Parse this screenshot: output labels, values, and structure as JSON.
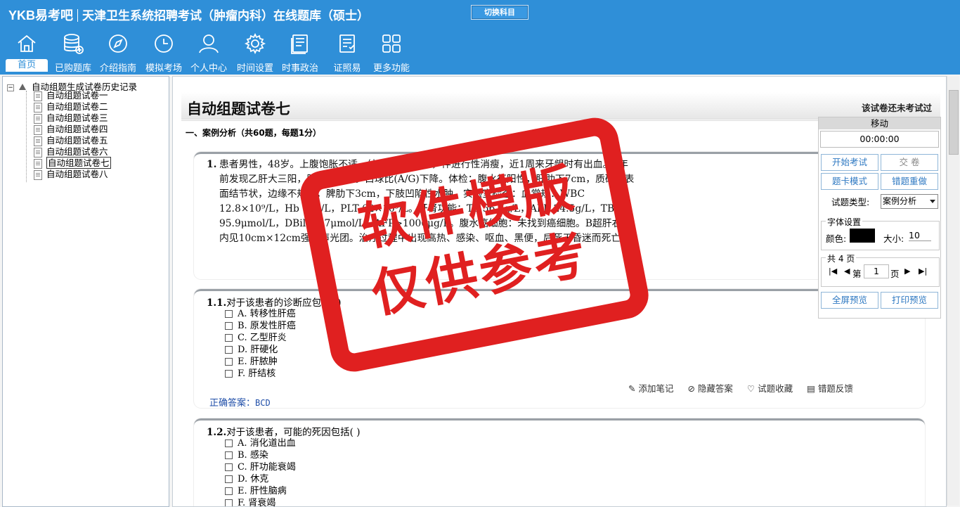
{
  "header": {
    "logo": "YKB易考吧",
    "title": "天津卫生系统招聘考试（肿瘤内科）在线题库（硕士）",
    "switch_label": "切换科目",
    "nav": [
      {
        "label": "首页",
        "icon": "home-icon"
      },
      {
        "label": "已购题库",
        "icon": "database-icon"
      },
      {
        "label": "介绍指南",
        "icon": "compass-icon"
      },
      {
        "label": "模拟考场",
        "icon": "clock-icon"
      },
      {
        "label": "个人中心",
        "icon": "user-icon"
      },
      {
        "label": "时间设置",
        "icon": "gear-icon"
      },
      {
        "label": "时事政治",
        "icon": "news-icon"
      },
      {
        "label": "证照易",
        "icon": "certificate-icon"
      },
      {
        "label": "更多功能",
        "icon": "grid-icon"
      }
    ]
  },
  "tree": {
    "root": "自动组题生成试卷历史记录",
    "items": [
      "自动组题试卷一",
      "自动组题试卷二",
      "自动组题试卷三",
      "自动组题试卷四",
      "自动组题试卷五",
      "自动组题试卷六",
      "自动组题试卷七",
      "自动组题试卷八"
    ]
  },
  "paper": {
    "title": "自动组题试卷七",
    "status": "该试卷还未考试过",
    "section": "一、案例分析（共60题，每题1分）",
    "stem_no": "1.",
    "stem": "患者男性，48岁。上腹饱胀不适、纳差乏力1月余，伴进行性消瘦，近1周来牙龈时有出血。2年前发现乙肝大三阳，肝功能异常。白球比(A/G)下降。体检：腹水征阳性，肝肋下7cm，质硬，表面结节状，边缘不规则，脾肋下3cm，下肢凹陷性水肿。实验室检查：血常规：WBC 12.8×10⁹/L，Hb 96g/L，PLT 62×10⁹/L。肝肾功能：TP 56.7g/L，ALB 24.5g/L，TBil 95.9μmol/L，DBil 46.7μmol/L，AFP>1000μg/L。腹水癌细胞：未找到癌细胞。B超肝右叶内见10cm×12cm强回声光团。治疗过程中出现高热、感染、呕血、黑便，后死于昏迷而死亡。",
    "q1": {
      "no": "1.1.",
      "text": "对于该患者的诊断应包括( )",
      "options": [
        "A. 转移性肝癌",
        "B. 原发性肝癌",
        "C. 乙型肝炎",
        "D. 肝硬化",
        "E. 肝脓肿",
        "F. 肝结核"
      ],
      "answer_label": "正确答案：",
      "answer": "BCD"
    },
    "q2": {
      "no": "1.2.",
      "text": "对于该患者，可能的死因包括( )",
      "options": [
        "A. 消化道出血",
        "B. 感染",
        "C. 肝功能衰竭",
        "D. 休克",
        "E. 肝性脑病",
        "F. 肾衰竭"
      ]
    },
    "tools": [
      "添加笔记",
      "隐藏答案",
      "试题收藏",
      "错题反馈"
    ]
  },
  "panel": {
    "head": "移动",
    "timer": "00:00:00",
    "start": "开始考试",
    "submit": "交  卷",
    "card_mode": "题卡模式",
    "redo": "错题重做",
    "type_label": "试题类型:",
    "type_value": "案例分析",
    "font_legend": "字体设置",
    "color_label": "颜色:",
    "size_label": "大小:",
    "size_value": "10",
    "color_value": "#000000",
    "pages_legend": "共 4 页",
    "page_prefix": "第",
    "page_value": "1",
    "page_suffix": "页",
    "fullscreen": "全屏预览",
    "print": "打印预览"
  },
  "watermark": {
    "line1": "软件模版",
    "line2": "仅供参考"
  }
}
